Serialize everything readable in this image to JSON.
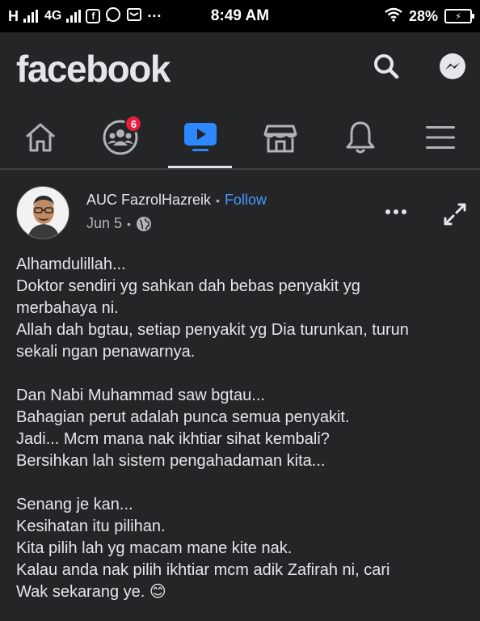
{
  "status_bar": {
    "network_left": "H",
    "network_type": "4G",
    "more_indicator": "···",
    "time": "8:49 AM",
    "battery": "28%"
  },
  "header": {
    "logo": "facebook",
    "search_icon": "search-icon",
    "messenger_icon": "messenger-icon"
  },
  "nav": {
    "tabs": [
      {
        "name": "home",
        "icon": "home-icon"
      },
      {
        "name": "groups",
        "icon": "groups-icon",
        "badge": "6"
      },
      {
        "name": "watch",
        "icon": "watch-icon",
        "active": true
      },
      {
        "name": "marketplace",
        "icon": "marketplace-icon"
      },
      {
        "name": "notifications",
        "icon": "bell-icon"
      },
      {
        "name": "menu",
        "icon": "menu-icon"
      }
    ]
  },
  "post": {
    "author": "AUC FazrolHazreik",
    "separator": "•",
    "follow": "Follow",
    "date": "Jun 5",
    "meta_separator": "•",
    "privacy_icon": "globe-icon",
    "paragraphs": [
      [
        "Alhamdulillah...",
        "Doktor sendiri yg sahkan dah bebas penyakit yg",
        "merbahaya ni.",
        "Allah dah bgtau, setiap penyakit yg Dia turunkan, turun",
        "sekali ngan penawarnya."
      ],
      [
        "Dan Nabi Muhammad saw bgtau...",
        "Bahagian perut adalah punca semua penyakit.",
        "Jadi... Mcm mana nak ikhtiar sihat kembali?",
        "Bersihkan lah sistem pengahadaman kita..."
      ],
      [
        "Senang je kan...",
        "Kesihatan itu pilihan.",
        "Kita pilih lah yg macam mane kite nak.",
        "Kalau anda nak pilih ikhtiar mcm adik Zafirah ni, cari",
        "Wak sekarang ye. 😊"
      ]
    ]
  },
  "colors": {
    "background": "#242526",
    "status_bar": "#000000",
    "text": "#e4e6eb",
    "secondary_text": "#b0b3b8",
    "link": "#4599ff",
    "watch_active": "#2d88ff",
    "badge": "#e41e3f"
  }
}
